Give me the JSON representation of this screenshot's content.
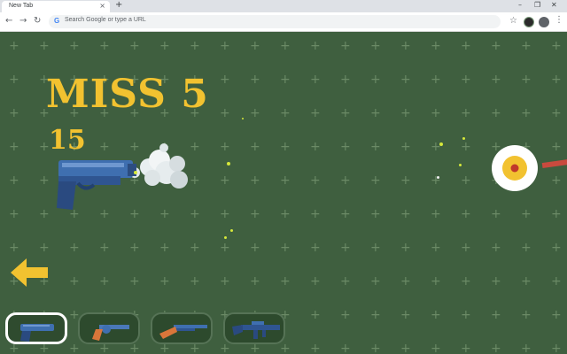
{
  "browser": {
    "tab_title": "New Tab",
    "tab_close": "×",
    "new_tab": "+",
    "omnibox_placeholder": "Search Google or type a URL",
    "g_letter": "G"
  },
  "hud": {
    "miss_text": "MISS 5",
    "score": "15"
  },
  "weapons": [
    {
      "name": "pistol",
      "selected": true
    },
    {
      "name": "revolver",
      "selected": false
    },
    {
      "name": "shotgun",
      "selected": false
    },
    {
      "name": "assault-rifle",
      "selected": false
    }
  ],
  "colors": {
    "background": "#3f5f3f",
    "hud_text": "#f2c230",
    "target_ring": "#ffffff",
    "target_center": "#f2c230",
    "target_dot": "#c0392b"
  }
}
